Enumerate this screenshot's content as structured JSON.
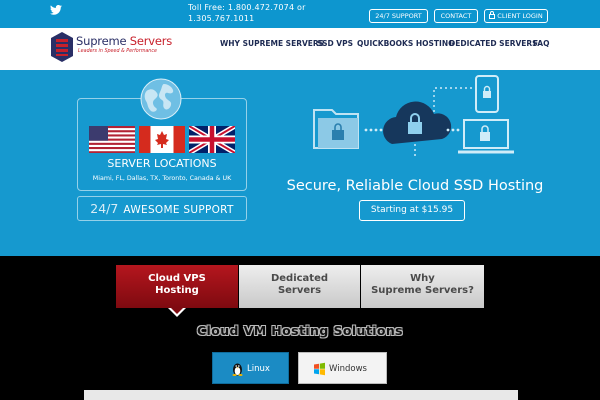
{
  "topbar": {
    "tollfree_line1": "Toll Free: 1.800.472.7074 or",
    "tollfree_line2": "1.305.767.1011",
    "support_label": "24/7 SUPPORT",
    "contact_label": "CONTACT",
    "login_label": "CLIENT LOGIN"
  },
  "logo": {
    "name_part1": "Supreme",
    "name_part2": "Servers",
    "tagline": "Leaders in Speed & Performance"
  },
  "nav": [
    "WHY SUPREME SERVERS",
    "SSD VPS",
    "QUICKBOOKS HOSTING",
    "DEDICATED SERVERS",
    "FAQ"
  ],
  "hero": {
    "locations_title": "SERVER LOCATIONS",
    "locations_cities": "Miami, FL, Dallas, TX, Toronto, Canada & UK",
    "support_number": "24/7",
    "support_text": "AWESOME SUPPORT",
    "headline": "Secure, Reliable Cloud SSD Hosting",
    "price_button": "Starting at $15.95"
  },
  "tabs": [
    {
      "line1": "Cloud VPS",
      "line2": "Hosting"
    },
    {
      "line1": "Dedicated",
      "line2": "Servers"
    },
    {
      "line1": "Why",
      "line2": "Supreme Servers?"
    }
  ],
  "solutions_title": "Cloud VM Hosting Solutions",
  "os_buttons": {
    "linux": "Linux",
    "windows": "Windows"
  },
  "colors": {
    "topbar": "#0d96cf",
    "hero": "#1699cf",
    "active_tab": "#a8141b",
    "brand_red": "#c8202b",
    "brand_navy": "#2a2f66"
  }
}
